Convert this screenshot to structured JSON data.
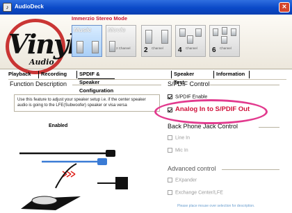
{
  "window": {
    "title": "AudioDeck",
    "app_icon": "audio-icon",
    "close_glyph": "×"
  },
  "header": {
    "logo_main": "Vinyl",
    "logo_sub": "Audio",
    "mode_group_label": "Immerzio Stereo Mode",
    "modes": [
      {
        "label": "Music",
        "sub": "",
        "active": true
      },
      {
        "label": "Movie",
        "sub": "2 Channel",
        "active": false
      }
    ],
    "channel_options": [
      {
        "num": "2",
        "sub": "Channel"
      },
      {
        "num": "4",
        "sub": "Channel"
      },
      {
        "num": "6",
        "sub": "Channel"
      }
    ]
  },
  "tabs": [
    "Playback",
    "Recording",
    "SPDIF & Speaker Configuration",
    "Speaker Test",
    "Information"
  ],
  "active_tab": "SPDIF & Speaker Configuration",
  "function_description": {
    "title": "Function Description",
    "text": "Use this feature to adjust your speaker setup i.e. if the center speaker audio is going to the LFE(Subwoofer) speaker or visa versa",
    "status": "Enabled"
  },
  "spdif_control": {
    "title": "S/PDIF Control",
    "options": [
      {
        "label": "S/PDIF Enable",
        "checked": true
      },
      {
        "label": "Analog In to S/PDIF Out",
        "checked": true
      }
    ]
  },
  "back_phone_jack": {
    "title": "Back Phone Jack Control",
    "options": [
      {
        "label": "Line In",
        "checked": false
      },
      {
        "label": "Mic In",
        "checked": false
      }
    ]
  },
  "advanced_control": {
    "title": "Advanced control",
    "options": [
      {
        "label": "EXpander",
        "checked": false
      },
      {
        "label": "Exchange Center/LFE",
        "checked": false
      }
    ]
  },
  "hint": "Please place mouse over selection for description.",
  "colors": {
    "titlebar": "#0a49c8",
    "highlight": "#d0103a",
    "oval": "#e23a8e",
    "mode_label": "#c8102e"
  }
}
